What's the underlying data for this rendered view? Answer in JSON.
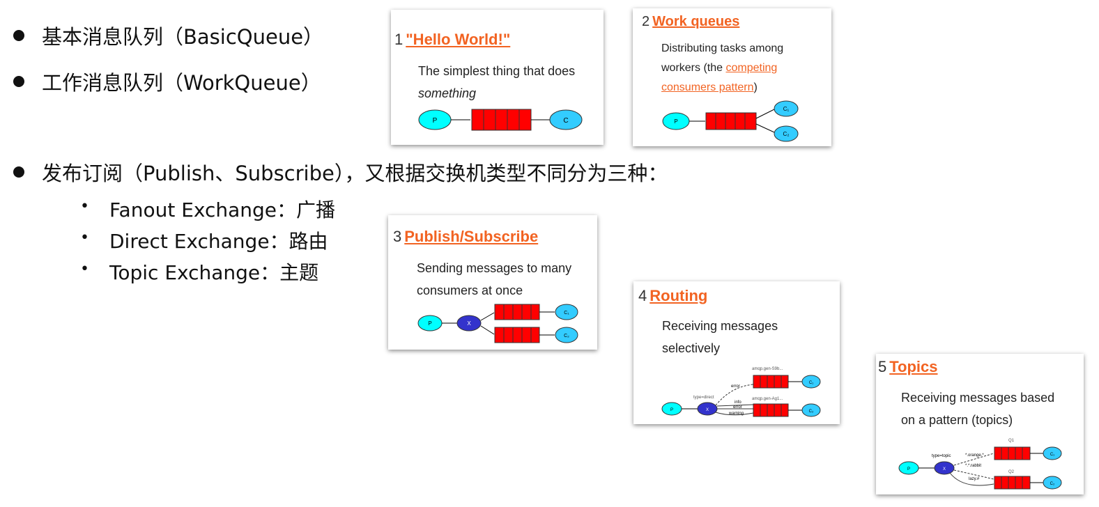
{
  "bullets": [
    {
      "text": "基本消息队列（BasicQueue）"
    },
    {
      "text": "工作消息队列（WorkQueue）"
    },
    {
      "text": "发布订阅（Publish、Subscribe），又根据交换机类型不同分为三种："
    }
  ],
  "sub_bullets": [
    {
      "text": "Fanout Exchange：广播"
    },
    {
      "text": "Direct Exchange：路由"
    },
    {
      "text": "Topic Exchange：主题"
    }
  ],
  "cards": [
    {
      "num": "1",
      "title": "\"Hello World!\"",
      "desc1": "The simplest thing that does",
      "desc2": "something",
      "labels": {
        "p": "P",
        "c": "C"
      }
    },
    {
      "num": "2",
      "title": "Work queues",
      "desc1": "Distributing tasks among",
      "desc2": "workers (the ",
      "link1": "competing",
      "link2": "consumers pattern",
      "desc3": ")",
      "labels": {
        "p": "P",
        "c1": "C₁",
        "c2": "C₂"
      }
    },
    {
      "num": "3",
      "title": "Publish/Subscribe",
      "desc1": "Sending messages to many",
      "desc2": "consumers at once",
      "labels": {
        "p": "P",
        "x": "X",
        "c1": "C₁",
        "c2": "C₂"
      }
    },
    {
      "num": "4",
      "title": "Routing",
      "desc1": "Receiving messages",
      "desc2": "selectively",
      "labels": {
        "p": "P",
        "x": "X",
        "c1": "C₁",
        "c2": "C₂",
        "type": "type=direct",
        "q1": "amqp.gen-S9b...",
        "q2": "amqp.gen-Ag1...",
        "k1": "error",
        "k2": "info",
        "k3": "error",
        "k4": "warning"
      }
    },
    {
      "num": "5",
      "title": "Topics",
      "desc1": "Receiving messages based",
      "desc2": "on a pattern (topics)",
      "labels": {
        "p": "P",
        "x": "X",
        "c1": "C₁",
        "c2": "C₂",
        "type": "type=topic",
        "q1": "Q1",
        "q2": "Q2",
        "k1": "*.orange.*",
        "k2": "*.*.rabbit",
        "k3": "lazy.#"
      }
    }
  ],
  "colors": {
    "link": "#f26322",
    "queue": "#ff0000",
    "producer": "#00ffff",
    "exchange": "#3333cc",
    "consumer": "#33ccff"
  }
}
